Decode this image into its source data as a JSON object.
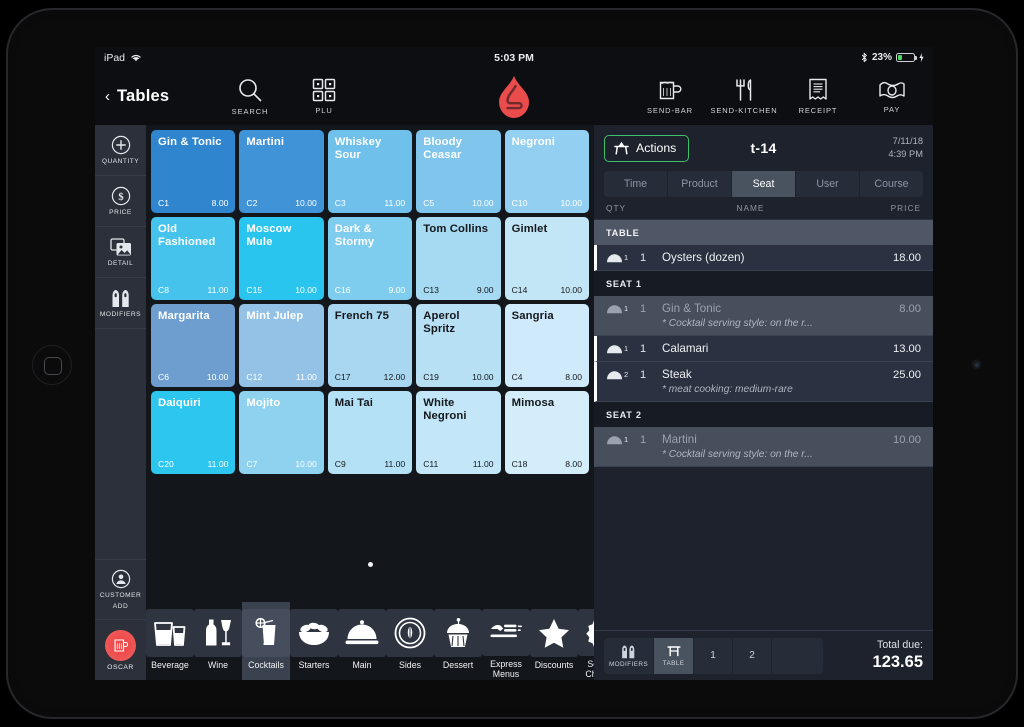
{
  "status_bar": {
    "device": "iPad",
    "wifi_icon": "wifi-icon",
    "time": "5:03 PM",
    "bluetooth_icon": "bluetooth-icon",
    "battery_percent": "23%",
    "charging_icon": "charging-bolt-icon"
  },
  "topnav": {
    "back_icon": "chevron-left-icon",
    "back_label": "Tables",
    "buttons": [
      {
        "label": "SEARCH",
        "icon": "search-icon"
      },
      {
        "label": "PLU",
        "icon": "plu-grid-icon"
      }
    ],
    "logo": "lightspeed-flame-logo",
    "right_buttons": [
      {
        "label": "SEND-BAR",
        "icon": "beer-mug-icon"
      },
      {
        "label": "SEND-KITCHEN",
        "icon": "fork-knife-icon"
      },
      {
        "label": "RECEIPT",
        "icon": "receipt-icon"
      },
      {
        "label": "PAY",
        "icon": "cash-icon"
      }
    ]
  },
  "rail": {
    "items": [
      {
        "label": "QUANTITY",
        "icon": "plus-circle-icon"
      },
      {
        "label": "PRICE",
        "icon": "dollar-circle-icon"
      },
      {
        "label": "DETAIL",
        "icon": "images-icon"
      },
      {
        "label": "MODIFIERS",
        "icon": "salt-pepper-icon"
      }
    ],
    "customer_add": {
      "label_line1": "CUSTOMER",
      "label_line2": "ADD",
      "icon": "person-circle-icon"
    },
    "user": {
      "label": "OSCAR",
      "icon": "beer-mug-avatar-icon"
    }
  },
  "grid": {
    "tiles": [
      {
        "name": "Gin & Tonic",
        "code": "C1",
        "price": "8.00",
        "bg": "#2f86cf",
        "fg": "#ffffff"
      },
      {
        "name": "Martini",
        "code": "C2",
        "price": "10.00",
        "bg": "#4193d8",
        "fg": "#ffffff"
      },
      {
        "name": "Whiskey Sour",
        "code": "C3",
        "price": "11.00",
        "bg": "#6fc0ea",
        "fg": "#ffffff"
      },
      {
        "name": "Bloody Ceasar",
        "code": "C5",
        "price": "10.00",
        "bg": "#80c6ec",
        "fg": "#ffffff"
      },
      {
        "name": "Negroni",
        "code": "C10",
        "price": "10.00",
        "bg": "#92cff0",
        "fg": "#ffffff"
      },
      {
        "name": "Old Fashioned",
        "code": "C8",
        "price": "11.00",
        "bg": "#45c3ec",
        "fg": "#ffffff"
      },
      {
        "name": "Moscow Mule",
        "code": "C15",
        "price": "10.00",
        "bg": "#2ac5ee",
        "fg": "#ffffff"
      },
      {
        "name": "Dark & Stormy",
        "code": "C16",
        "price": "9.00",
        "bg": "#7fcdee",
        "fg": "#ffffff"
      },
      {
        "name": "Tom Collins",
        "code": "C13",
        "price": "9.00",
        "bg": "#a6d9f2",
        "fg": "#15181c"
      },
      {
        "name": "Gimlet",
        "code": "C14",
        "price": "10.00",
        "bg": "#c3e6f7",
        "fg": "#15181c"
      },
      {
        "name": "Margarita",
        "code": "C6",
        "price": "10.00",
        "bg": "#6e9ed0",
        "fg": "#ffffff"
      },
      {
        "name": "Mint Julep",
        "code": "C12",
        "price": "11.00",
        "bg": "#93c2e6",
        "fg": "#ffffff"
      },
      {
        "name": "French 75",
        "code": "C17",
        "price": "12.00",
        "bg": "#a9d7f2",
        "fg": "#15181c"
      },
      {
        "name": "Aperol Spritz",
        "code": "C19",
        "price": "10.00",
        "bg": "#b8e0f5",
        "fg": "#15181c"
      },
      {
        "name": "Sangria",
        "code": "C4",
        "price": "8.00",
        "bg": "#cfeafa",
        "fg": "#15181c"
      },
      {
        "name": "Daiquiri",
        "code": "C20",
        "price": "11.00",
        "bg": "#2dc6ef",
        "fg": "#ffffff"
      },
      {
        "name": "Mojito",
        "code": "C7",
        "price": "10.00",
        "bg": "#8ed2f0",
        "fg": "#ffffff"
      },
      {
        "name": "Mai Tai",
        "code": "C9",
        "price": "11.00",
        "bg": "#b5e1f6",
        "fg": "#15181c"
      },
      {
        "name": "White Negroni",
        "code": "C11",
        "price": "11.00",
        "bg": "#c3e7f8",
        "fg": "#15181c"
      },
      {
        "name": "Mimosa",
        "code": "C18",
        "price": "8.00",
        "bg": "#d3edfb",
        "fg": "#15181c"
      }
    ],
    "page_dot": "page-indicator-dot"
  },
  "categories": [
    {
      "label": "Beverage",
      "icon": "glasses-icon",
      "active": false
    },
    {
      "label": "Wine",
      "icon": "wine-bottle-icon",
      "active": false
    },
    {
      "label": "Cocktails",
      "icon": "cocktail-glass-icon",
      "active": true
    },
    {
      "label": "Starters",
      "icon": "salad-bowl-icon",
      "active": false
    },
    {
      "label": "Main",
      "icon": "cloche-icon",
      "active": false
    },
    {
      "label": "Sides",
      "icon": "plate-icon",
      "active": false
    },
    {
      "label": "Dessert",
      "icon": "cupcake-icon",
      "active": false
    },
    {
      "label": "Express Menus",
      "icon": "express-menu-icon",
      "active": false
    },
    {
      "label": "Discounts",
      "icon": "star-icon",
      "active": false
    },
    {
      "label": "Service Charges",
      "icon": "percent-badge-icon",
      "active": false
    }
  ],
  "order": {
    "actions_label": "Actions",
    "actions_icon": "actions-table-icon",
    "table_name": "t-14",
    "date": "7/11/18",
    "time": "4:39 PM",
    "tabs": [
      {
        "label": "Time",
        "active": false
      },
      {
        "label": "Product",
        "active": false
      },
      {
        "label": "Seat",
        "active": true
      },
      {
        "label": "User",
        "active": false
      },
      {
        "label": "Course",
        "active": false
      }
    ],
    "columns": {
      "qty": "QTY",
      "name": "NAME",
      "price": "PRICE"
    },
    "sections": [
      {
        "header": "TABLE",
        "kind": "table",
        "items": [
          {
            "course": "1",
            "qty": "1",
            "name": "Oysters (dozen)",
            "price": "18.00",
            "note": "",
            "dim": false
          }
        ]
      },
      {
        "header": "SEAT 1",
        "kind": "seat",
        "items": [
          {
            "course": "1",
            "qty": "1",
            "name": "Gin & Tonic",
            "price": "8.00",
            "note": "* Cocktail serving style: on the r...",
            "dim": true
          },
          {
            "course": "1",
            "qty": "1",
            "name": "Calamari",
            "price": "13.00",
            "note": "",
            "dim": false
          },
          {
            "course": "2",
            "qty": "1",
            "name": "Steak",
            "price": "25.00",
            "note": "* meat cooking: medium-rare",
            "dim": false
          }
        ]
      },
      {
        "header": "SEAT 2",
        "kind": "seat",
        "items": [
          {
            "course": "1",
            "qty": "1",
            "name": "Martini",
            "price": "10.00",
            "note": "* Cocktail serving style: on the r...",
            "dim": true
          }
        ]
      }
    ],
    "footer": {
      "modifiers_label": "MODIFIERS",
      "modifiers_icon": "salt-pepper-icon",
      "table_label": "TABLE",
      "table_icon": "table-stool-icon",
      "seats": [
        "1",
        "2"
      ],
      "total_label": "Total due:",
      "total_value": "123.65"
    }
  },
  "colors": {
    "accent_green": "#3ec16a",
    "brand_red": "#ee4b4b",
    "panel_bg": "#1d222c",
    "grid_bg": "#13161a",
    "rail_bg": "#2b303a"
  }
}
